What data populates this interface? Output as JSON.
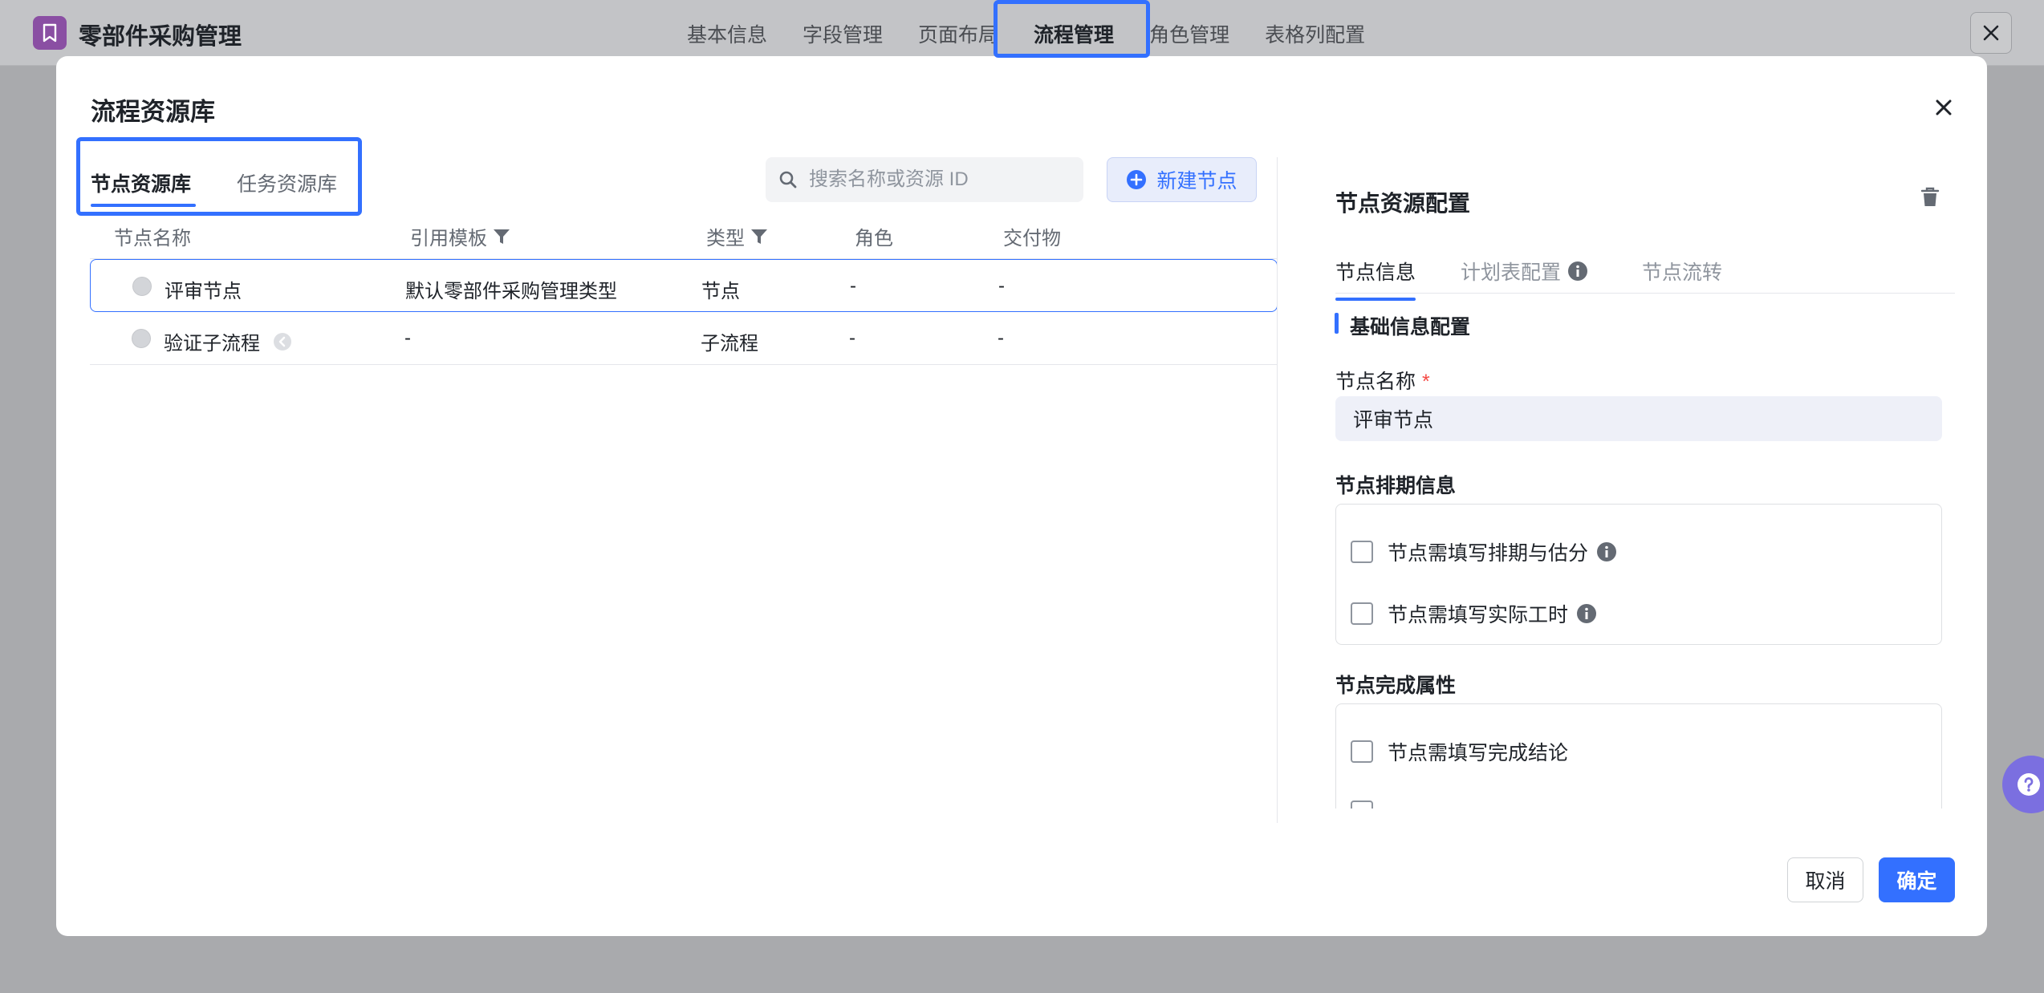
{
  "app": {
    "title": "零部件采购管理",
    "nav": [
      {
        "label": "基本信息"
      },
      {
        "label": "字段管理"
      },
      {
        "label": "页面布局"
      },
      {
        "label": "流程管理",
        "active": true
      },
      {
        "label": "角色管理"
      },
      {
        "label": "表格列配置"
      }
    ],
    "icons": {
      "logo": "bookmark-icon",
      "close": "close-icon"
    },
    "colors": {
      "logo_bg": "#8a4fa3",
      "accent": "#3370ff"
    }
  },
  "modal": {
    "title": "流程资源库",
    "tabs": [
      {
        "label": "节点资源库",
        "active": true
      },
      {
        "label": "任务资源库"
      }
    ],
    "search": {
      "placeholder": "搜索名称或资源 ID",
      "value": ""
    },
    "new_node_label": "新建节点",
    "table": {
      "columns": [
        "节点名称",
        "引用模板",
        "类型",
        "角色",
        "交付物"
      ],
      "filterable_columns": [
        "引用模板",
        "类型"
      ],
      "rows": [
        {
          "name": "评审节点",
          "template": "默认零部件采购管理类型",
          "type": "节点",
          "role": "-",
          "deliverable": "-",
          "selected": true
        },
        {
          "name": "验证子流程",
          "template": "-",
          "type": "子流程",
          "role": "-",
          "deliverable": "-",
          "has_subflow_icon": true
        }
      ]
    },
    "panel": {
      "title": "节点资源配置",
      "tabs": [
        {
          "label": "节点信息",
          "active": true
        },
        {
          "label": "计划表配置",
          "info_icon": true
        },
        {
          "label": "节点流转"
        }
      ],
      "section_title": "基础信息配置",
      "name_label": "节点名称",
      "required_mark": "*",
      "name_value": "评审节点",
      "schedule_group": {
        "title": "节点排期信息",
        "options": [
          {
            "label": "节点需填写排期与估分",
            "checked": false,
            "info_icon": true
          },
          {
            "label": "节点需填写实际工时",
            "checked": false,
            "info_icon": true
          }
        ]
      },
      "complete_group": {
        "title": "节点完成属性",
        "options": [
          {
            "label": "节点需填写完成结论",
            "checked": false
          }
        ]
      }
    },
    "footer": {
      "cancel_label": "取消",
      "ok_label": "确定"
    }
  }
}
